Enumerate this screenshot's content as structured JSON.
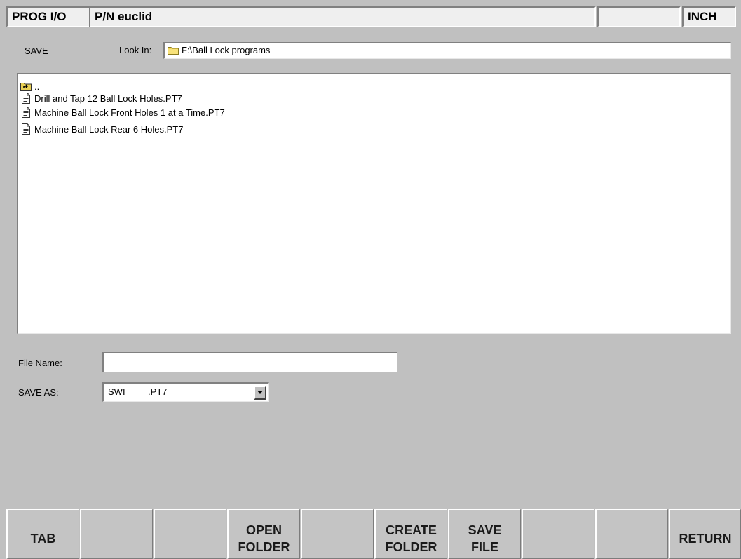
{
  "header": {
    "mode": "PROG I/O",
    "part_number": "P/N euclid",
    "blank": "",
    "units": "INCH"
  },
  "dialog": {
    "action_label": "SAVE",
    "look_in_label": "Look In:",
    "look_in_path": "F:\\Ball Lock programs",
    "parent_dir_label": "..",
    "files": [
      "Drill and Tap 12 Ball Lock Holes.PT7",
      "Machine Ball Lock Front Holes 1 at a Time.PT7",
      "Machine Ball Lock Rear 6 Holes.PT7"
    ],
    "file_name_label": "File Name:",
    "file_name_value": "",
    "save_as_label": "SAVE AS:",
    "save_as_value": "SWI         .PT7"
  },
  "status": {
    "text": ""
  },
  "softkeys": [
    "TAB",
    "",
    "",
    "OPEN\nFOLDER",
    "",
    "CREATE\nFOLDER",
    "SAVE\nFILE",
    "",
    "",
    "RETURN"
  ],
  "icons": {
    "folder": "folder-icon",
    "parent": "parent-folder-icon",
    "file": "document-icon",
    "dropdown": "chevron-down-icon"
  }
}
